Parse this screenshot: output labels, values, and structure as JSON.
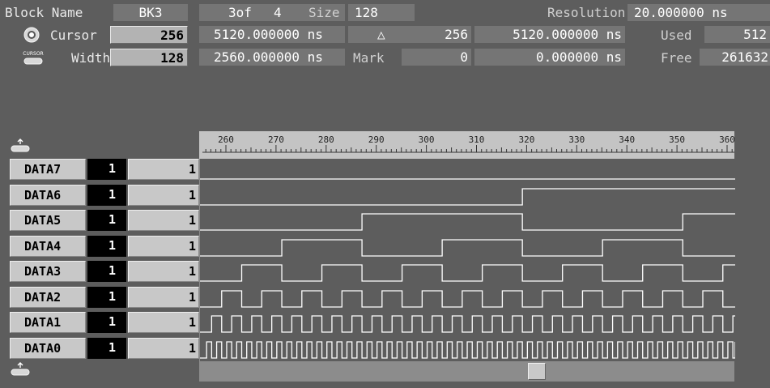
{
  "header": {
    "block_name_label": "Block Name",
    "block_name_value": "BK3",
    "block_index": "3of",
    "block_count": "4",
    "size_label": "Size",
    "size_value": "128",
    "resolution_label": "Resolution",
    "resolution_value": "20.000000 ns"
  },
  "cursor": {
    "label": "Cursor",
    "value": "256",
    "time": "5120.000000 ns"
  },
  "width": {
    "icon_label": "CURSOR",
    "label": "Width",
    "value": "128",
    "time": "2560.000000 ns"
  },
  "delta": {
    "symbol": "△",
    "value": "256",
    "time": "5120.000000 ns"
  },
  "mark": {
    "label": "Mark",
    "value": "0",
    "time": "0.000000 ns"
  },
  "memory": {
    "used_label": "Used",
    "used_value": "512",
    "free_label": "Free",
    "free_value": "261632"
  },
  "ruler": {
    "ticks": [
      "260",
      "270",
      "280",
      "290",
      "300",
      "310",
      "320",
      "330",
      "340",
      "350",
      "360"
    ]
  },
  "channels": [
    {
      "name": "DATA7",
      "value": "1",
      "count": "1"
    },
    {
      "name": "DATA6",
      "value": "1",
      "count": "1"
    },
    {
      "name": "DATA5",
      "value": "1",
      "count": "1"
    },
    {
      "name": "DATA4",
      "value": "1",
      "count": "1"
    },
    {
      "name": "DATA3",
      "value": "1",
      "count": "1"
    },
    {
      "name": "DATA2",
      "value": "1",
      "count": "1"
    },
    {
      "name": "DATA1",
      "value": "1",
      "count": "1"
    },
    {
      "name": "DATA0",
      "value": "1",
      "count": "1"
    }
  ],
  "colors": {
    "background": "#5d5d5d",
    "waveform": "#ffffff",
    "field": "#757575",
    "input_field": "#b3b3b3",
    "channel_value_bg": "#000000"
  }
}
